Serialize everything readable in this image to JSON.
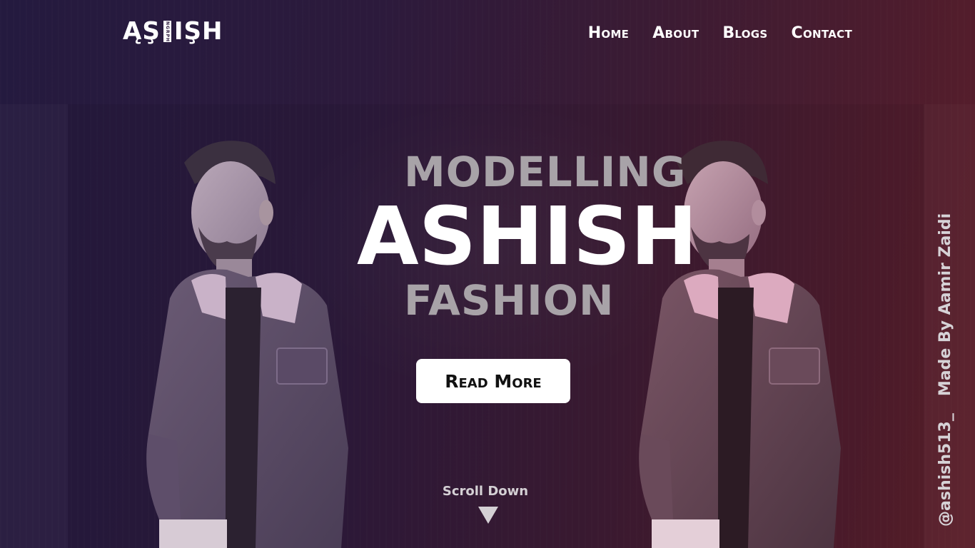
{
  "logo": {
    "text_left": "ĄŞ",
    "text_tag": "NGRPH",
    "text_right": "IŞH"
  },
  "nav": {
    "items": [
      {
        "label": "Home"
      },
      {
        "label": "About"
      },
      {
        "label": "Blogs"
      },
      {
        "label": "Contact"
      }
    ]
  },
  "hero": {
    "line1": "MODELLING",
    "line2": "ASHISH",
    "line3": "FASHION",
    "cta_label": "Read More"
  },
  "scroll": {
    "label": "Scroll Down",
    "icon": "triangle-down-icon"
  },
  "credit": {
    "handle": "@ashish513_",
    "made_by": "Made By Aamir Zaidi"
  },
  "colors": {
    "bg_left": "#241a3f",
    "bg_right": "#5c1f2a",
    "hero_muted": "#a8a3a8",
    "cta_bg": "#ffffff"
  }
}
